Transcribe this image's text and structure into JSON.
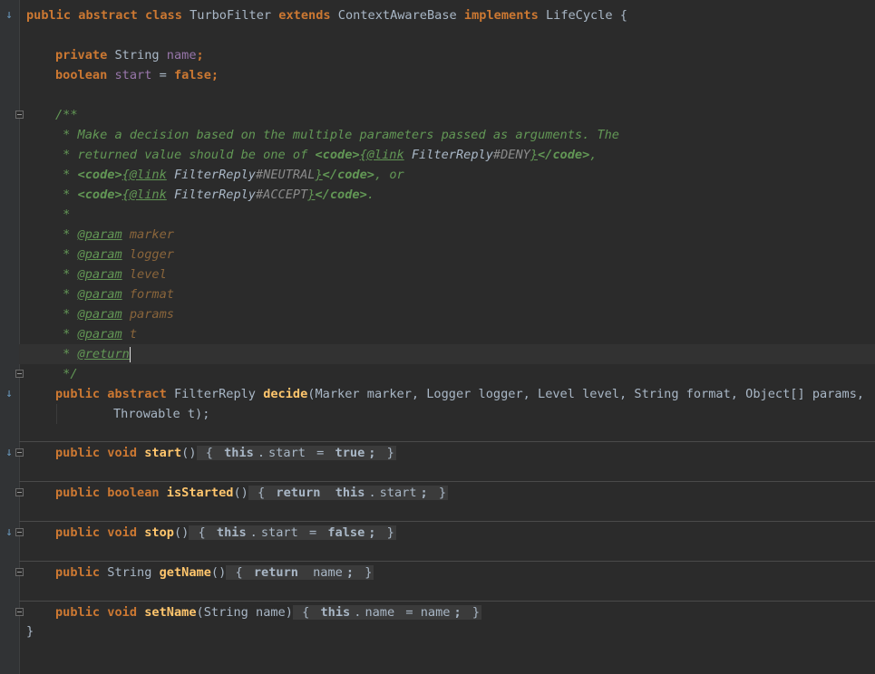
{
  "editor": {
    "lines": [
      {
        "id": "class-decl",
        "tokens": [
          "public",
          " ",
          "abstract",
          " ",
          "class",
          " TurboFilter ",
          "extends",
          " ContextAwareBase ",
          "implements",
          " LifeCycle {"
        ]
      },
      {
        "id": "field-name",
        "tokens": [
          "private",
          " String ",
          "name",
          ";"
        ]
      },
      {
        "id": "field-start",
        "tokens": [
          "boolean",
          " ",
          "start",
          " = ",
          "false",
          ";"
        ]
      },
      {
        "id": "doc-open",
        "text": "/**"
      },
      {
        "id": "doc-1",
        "text": " * Make a decision based on the multiple parameters passed as arguments. The"
      },
      {
        "id": "doc-2",
        "tokens": [
          " * returned value should be one of ",
          "<code>",
          "{",
          "@link",
          " FilterReply",
          "#DENY",
          "}",
          "</code>",
          ","
        ]
      },
      {
        "id": "doc-3",
        "tokens": [
          " * ",
          "<code>",
          "{",
          "@link",
          " FilterReply",
          "#NEUTRAL",
          "}",
          "</code>",
          ", or"
        ]
      },
      {
        "id": "doc-4",
        "tokens": [
          " * ",
          "<code>",
          "{",
          "@link",
          " FilterReply",
          "#ACCEPT",
          "}",
          "</code>",
          "."
        ]
      },
      {
        "id": "doc-5",
        "text": " *"
      },
      {
        "id": "doc-params",
        "params": [
          "marker",
          "logger",
          "level",
          "format",
          "params",
          "t"
        ]
      },
      {
        "id": "doc-return",
        "tokens": [
          " * ",
          "@return"
        ]
      },
      {
        "id": "doc-close",
        "text": " */"
      },
      {
        "id": "decide-1",
        "tokens": [
          "public",
          " ",
          "abstract",
          " FilterReply ",
          "decide",
          "(Marker marker, Logger logger, Level level, String format, Object[] params,"
        ]
      },
      {
        "id": "decide-2",
        "tokens": [
          "Throwable t);"
        ]
      },
      {
        "id": "start-method",
        "tokens": [
          "public",
          " ",
          "void",
          " ",
          "start",
          "()",
          " { ",
          "this",
          ".",
          "start",
          " = ",
          "true",
          ";",
          " }"
        ]
      },
      {
        "id": "isstarted-method",
        "tokens": [
          "public",
          " ",
          "boolean",
          " ",
          "isStarted",
          "()",
          " { ",
          "return",
          " ",
          "this",
          ".",
          "start",
          ";",
          " }"
        ]
      },
      {
        "id": "stop-method",
        "tokens": [
          "public",
          " ",
          "void",
          " ",
          "stop",
          "()",
          " { ",
          "this",
          ".",
          "start",
          " = ",
          "false",
          ";",
          " }"
        ]
      },
      {
        "id": "getname-method",
        "tokens": [
          "public",
          " String ",
          "getName",
          "()",
          " { ",
          "return",
          " ",
          "name",
          ";",
          " }"
        ]
      },
      {
        "id": "setname-method",
        "tokens": [
          "public",
          " ",
          "void",
          " ",
          "setName",
          "(String name)",
          " { ",
          "this",
          ".",
          "name",
          " = name",
          ";",
          " }"
        ]
      },
      {
        "id": "class-close",
        "text": "}"
      }
    ],
    "doc_param_tag": "@param",
    "doc_prefix": " * ",
    "gutter_marks": {
      "override": "↓"
    }
  },
  "colors": {
    "background": "#2b2b2b",
    "keyword": "#cc7832",
    "method": "#ffc66d",
    "field": "#9876aa",
    "doc_comment": "#629755",
    "text": "#a9b7c6",
    "gutter": "#313335"
  }
}
